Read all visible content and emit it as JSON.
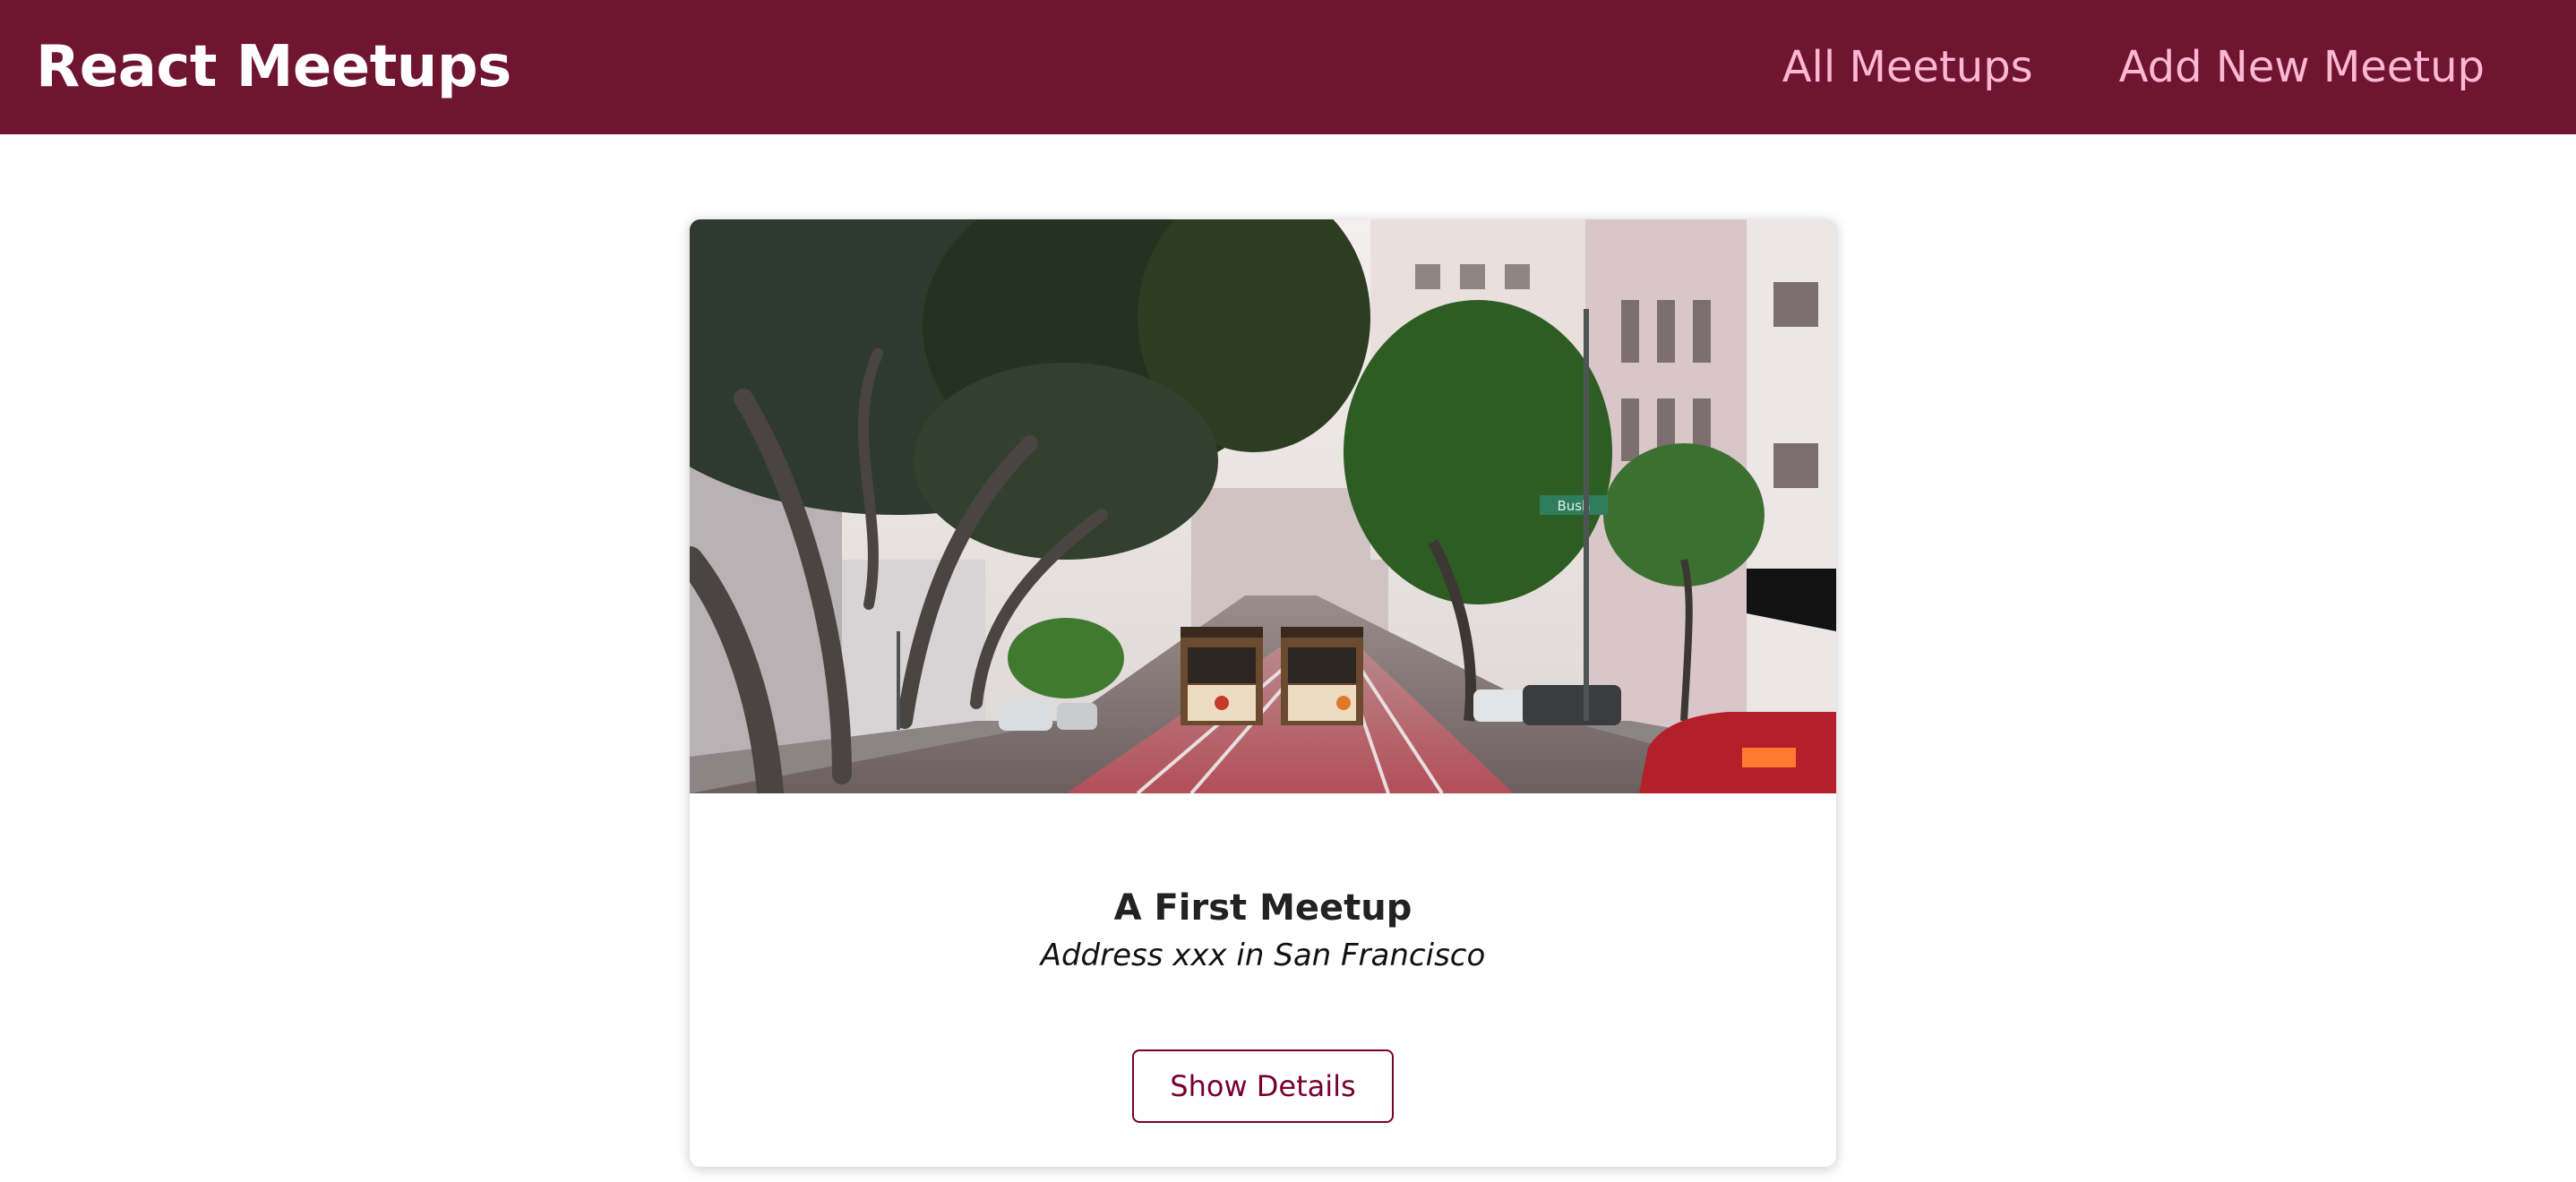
{
  "header": {
    "logo": "React Meetups",
    "nav": [
      {
        "label": "All Meetups"
      },
      {
        "label": "Add New Meetup"
      }
    ]
  },
  "meetups": [
    {
      "title": "A First Meetup",
      "address": "Address xxx in San Francisco",
      "button_label": "Show Details",
      "street_sign": "Bush",
      "image_description": "San Francisco street with cable cars between trees"
    }
  ],
  "colors": {
    "header_bg": "#6f1431",
    "nav_link": "#fcb8d2",
    "accent": "#77002e"
  }
}
